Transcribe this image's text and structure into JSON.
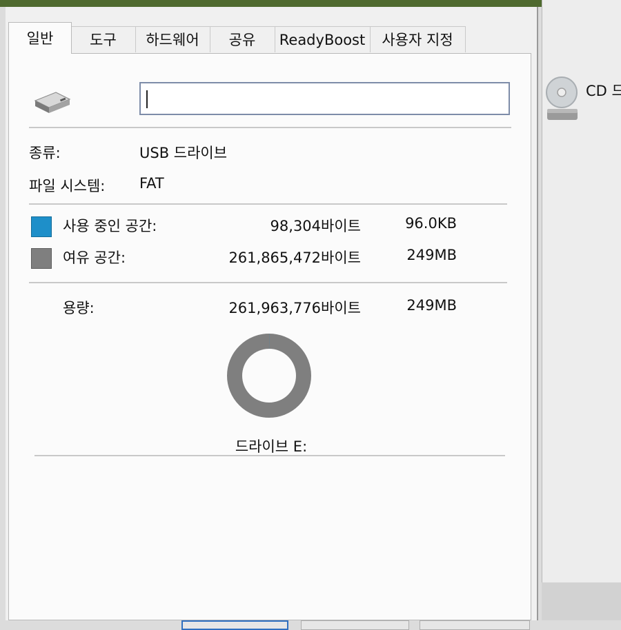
{
  "tabs": [
    {
      "label": "일반",
      "active": true
    },
    {
      "label": "도구"
    },
    {
      "label": "하드웨어"
    },
    {
      "label": "공유"
    },
    {
      "label": "ReadyBoost"
    },
    {
      "label": "사용자 지정"
    }
  ],
  "general": {
    "name_value": "",
    "type_label": "종류:",
    "type_value": "USB 드라이브",
    "fs_label": "파일 시스템:",
    "fs_value": "FAT",
    "used_label": "사용 중인 공간:",
    "used_bytes": "98,304바이트",
    "used_size": "96.0KB",
    "free_label": "여유 공간:",
    "free_bytes": "261,865,472바이트",
    "free_size": "249MB",
    "capacity_label": "용량:",
    "capacity_bytes": "261,963,776바이트",
    "capacity_size": "249MB",
    "drive_label": "드라이브 E:"
  },
  "usage": {
    "used_bytes": 98304,
    "free_bytes": 261865472,
    "used_color": "#1e8fc9",
    "free_color": "#7f7f7f"
  },
  "background": {
    "cd_label": "CD 드"
  },
  "icons": {
    "drive": "usb-drive-icon",
    "cd": "cd-drive-icon"
  }
}
